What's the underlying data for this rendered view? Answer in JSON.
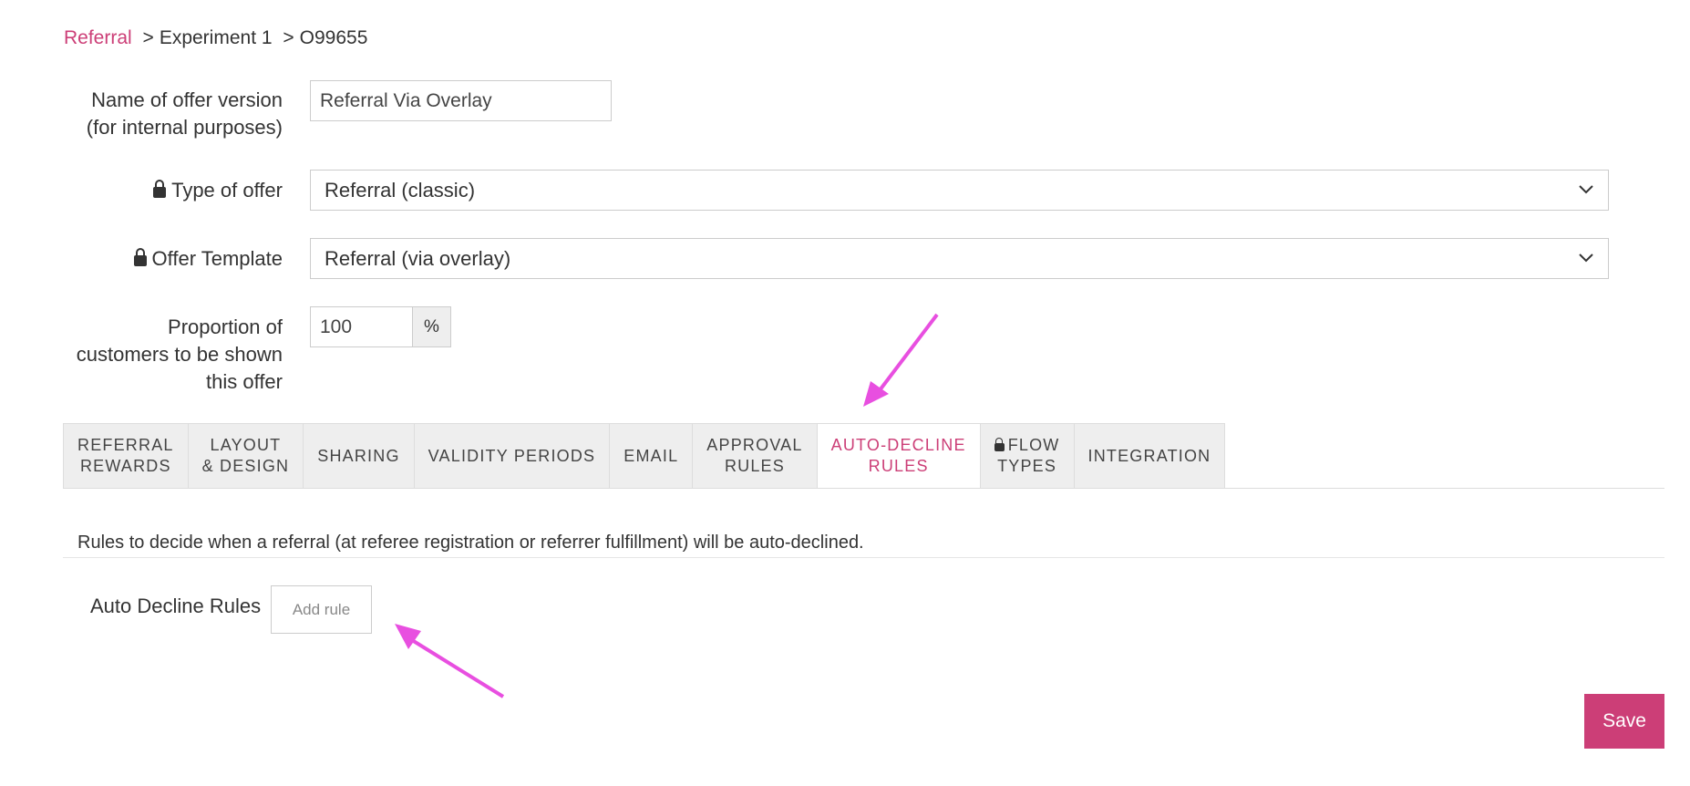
{
  "breadcrumb": {
    "root": "Referral",
    "separator": ">",
    "experiment": "Experiment 1",
    "offer_id": "O99655"
  },
  "form": {
    "name_label_line1": "Name of offer version",
    "name_label_line2": "(for internal purposes)",
    "name_value": "Referral Via Overlay",
    "type_label": "Type of offer",
    "type_value": "Referral (classic)",
    "template_label": "Offer Template",
    "template_value": "Referral (via overlay)",
    "proportion_label_line1": "Proportion of",
    "proportion_label_line2": "customers to be shown",
    "proportion_label_line3": "this offer",
    "proportion_value": "100",
    "proportion_unit": "%"
  },
  "tabs": [
    {
      "line1": "REFERRAL",
      "line2": "REWARDS"
    },
    {
      "line1": "LAYOUT",
      "line2": "& DESIGN"
    },
    {
      "line1": "SHARING",
      "line2": ""
    },
    {
      "line1": "VALIDITY PERIODS",
      "line2": ""
    },
    {
      "line1": "EMAIL",
      "line2": ""
    },
    {
      "line1": "APPROVAL",
      "line2": "RULES"
    },
    {
      "line1": "AUTO-DECLINE",
      "line2": "RULES"
    },
    {
      "line1": "FLOW",
      "line2": "TYPES"
    },
    {
      "line1": "INTEGRATION",
      "line2": ""
    }
  ],
  "active_tab": "AUTO-DECLINE RULES",
  "panel": {
    "description": "Rules to decide when a referral (at referee registration or referrer fulfillment) will be auto-declined.",
    "rules_label": "Auto Decline Rules",
    "add_rule_label": "Add rule"
  },
  "save_label": "Save",
  "colors": {
    "accent": "#cc3e77",
    "annotation_arrow": "#e84fe0",
    "tab_bg": "#eeeeee"
  }
}
